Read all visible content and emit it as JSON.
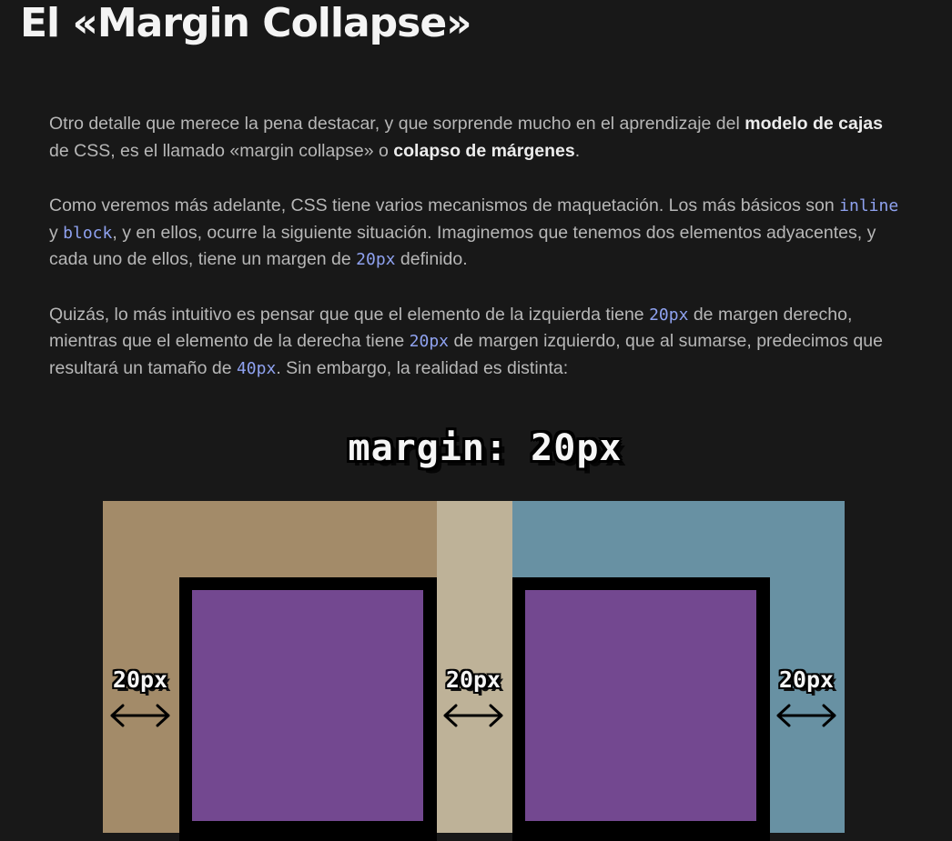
{
  "page": {
    "title": "El «Margin Collapse»"
  },
  "paragraphs": {
    "p1": {
      "t1": "Otro detalle que merece la pena destacar, y que sorprende mucho en el aprendizaje del ",
      "b1": "modelo de cajas",
      "t2": " de CSS, es el llamado «margin collapse» o ",
      "b2": "colapso de márgenes",
      "t3": "."
    },
    "p2": {
      "t1": "Como veremos más adelante, CSS tiene varios mecanismos de maquetación. Los más básicos son ",
      "c1": "inline",
      "t2": " y ",
      "c2": "block",
      "t3": ", y en ellos, ocurre la siguiente situación. Imaginemos que tenemos dos elementos adyacentes, y cada uno de ellos, tiene un margen de ",
      "c3": "20px",
      "t4": " definido."
    },
    "p3": {
      "t1": "Quizás, lo más intuitivo es pensar que que el elemento de la izquierda tiene ",
      "c1": "20px",
      "t2": " de margen derecho, mientras que el elemento de la derecha tiene ",
      "c2": "20px",
      "t3": " de margen izquierdo, que al sumarse, predecimos que resultará un tamaño de ",
      "c3": "40px",
      "t4": ". Sin embargo, la realidad es distinta:"
    }
  },
  "diagram": {
    "title": "margin: 20px",
    "measure_labels": [
      "20px",
      "20px",
      "20px"
    ],
    "arrow_icon": "double-arrow-icon",
    "colors": {
      "left_margin": "#a38b69",
      "shared_margin": "#beb298",
      "right_margin": "#6891a3",
      "box_border": "#000000",
      "box_fill": "#734890"
    }
  }
}
